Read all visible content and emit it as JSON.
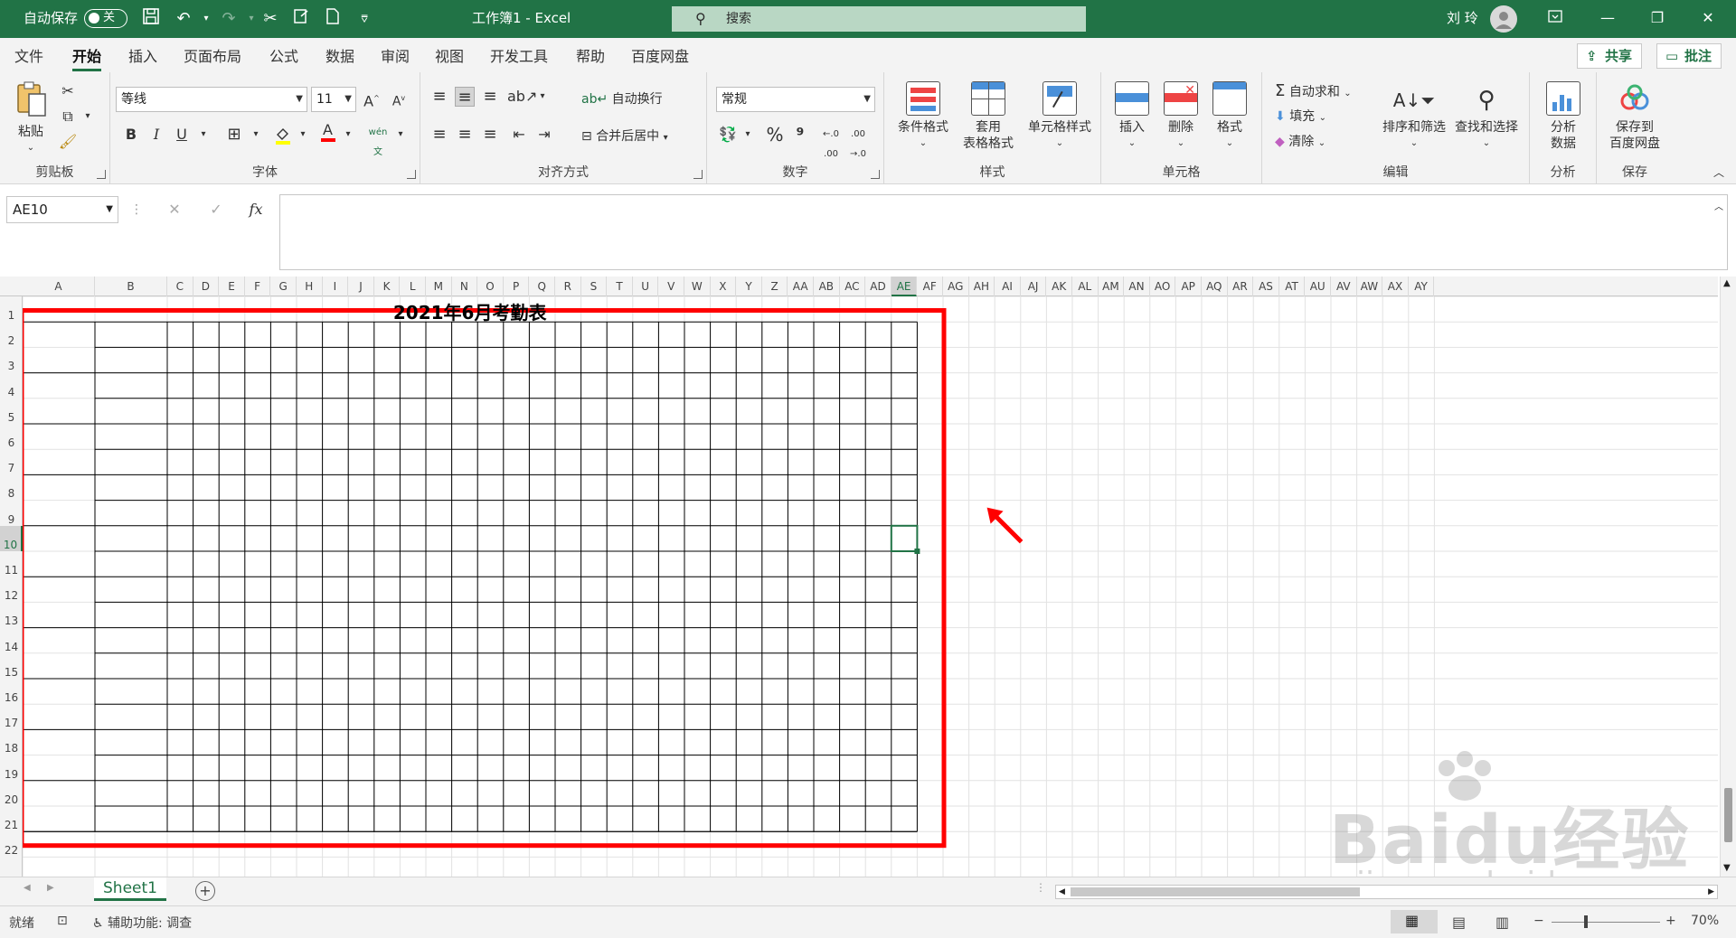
{
  "titlebar": {
    "autosave_label": "自动保存",
    "autosave_state": "关",
    "doc_title": "工作簿1 - Excel",
    "search_placeholder": "搜索",
    "user_name": "刘 玲"
  },
  "menu": {
    "tabs": [
      "文件",
      "开始",
      "插入",
      "页面布局",
      "公式",
      "数据",
      "审阅",
      "视图",
      "开发工具",
      "帮助",
      "百度网盘"
    ],
    "active_tab": "开始",
    "share_label": "共享",
    "comment_label": "批注"
  },
  "ribbon": {
    "clipboard": {
      "paste": "粘贴",
      "group": "剪贴板"
    },
    "font": {
      "name": "等线",
      "size": "11",
      "group": "字体",
      "bold": "B",
      "italic": "I",
      "underline": "U"
    },
    "alignment": {
      "wrap": "自动换行",
      "merge": "合并后居中",
      "group": "对齐方式"
    },
    "number": {
      "format": "常规",
      "group": "数字",
      "percent": "%"
    },
    "styles": {
      "cond": "条件格式",
      "table_1": "套用",
      "table_2": "表格格式",
      "cell_style": "单元格样式",
      "group": "样式"
    },
    "cells": {
      "insert": "插入",
      "delete": "删除",
      "format": "格式",
      "group": "单元格"
    },
    "editing": {
      "autosum": "自动求和",
      "fill": "填充",
      "clear": "清除",
      "sort": "排序和筛选",
      "find": "查找和选择",
      "group": "编辑"
    },
    "analysis": {
      "btn_1": "分析",
      "btn_2": "数据",
      "group": "分析"
    },
    "save": {
      "btn_1": "保存到",
      "btn_2": "百度网盘",
      "group": "保存"
    }
  },
  "formula_bar": {
    "name_box": "AE10",
    "fx": "fx",
    "content": ""
  },
  "sheet": {
    "title": "2021年6月考勤表",
    "columns": [
      "A",
      "B",
      "C",
      "D",
      "E",
      "F",
      "G",
      "H",
      "I",
      "J",
      "K",
      "L",
      "M",
      "N",
      "O",
      "P",
      "Q",
      "R",
      "S",
      "T",
      "U",
      "V",
      "W",
      "X",
      "Y",
      "Z",
      "AA",
      "AB",
      "AC",
      "AD",
      "AE",
      "AF",
      "AG",
      "AH",
      "AI",
      "AJ",
      "AK",
      "AL",
      "AM",
      "AN",
      "AO",
      "AP",
      "AQ",
      "AR",
      "AS",
      "AT",
      "AU",
      "AV",
      "AW",
      "AX",
      "AY"
    ],
    "rows": [
      "1",
      "2",
      "3",
      "4",
      "5",
      "6",
      "7",
      "8",
      "9",
      "10",
      "11",
      "12",
      "13",
      "14",
      "15",
      "16",
      "17",
      "18",
      "19",
      "20",
      "21",
      "22"
    ],
    "selected_cell": "AE10",
    "selected_col": "AE",
    "selected_row": "10",
    "highlight_color": "#ff0000",
    "accent_color": "#217346"
  },
  "tabs_bar": {
    "sheet_name": "Sheet1"
  },
  "status": {
    "ready": "就绪",
    "accessibility": "辅助功能: 调查",
    "zoom": "70%"
  },
  "watermark": {
    "line1": "Baidu经验",
    "line2": "jingyan.baidu.com"
  }
}
